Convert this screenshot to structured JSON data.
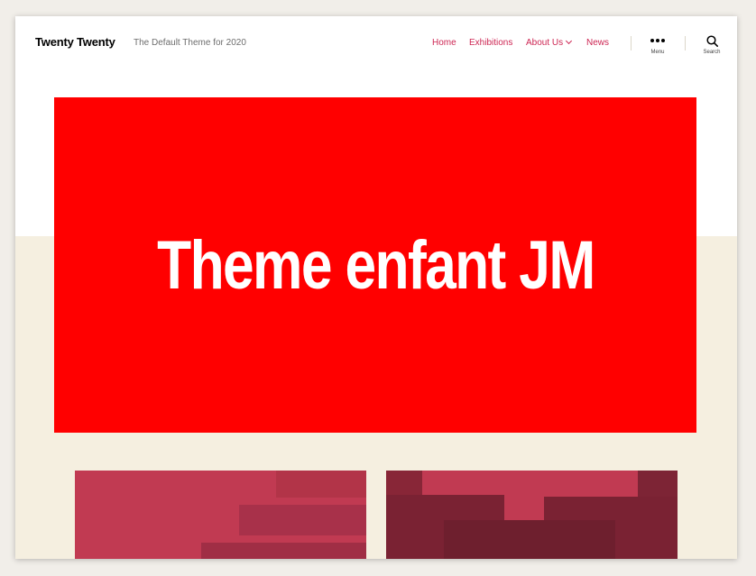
{
  "header": {
    "site_title": "Twenty Twenty",
    "site_description": "The Default Theme for 2020"
  },
  "nav": {
    "items": [
      {
        "label": "Home"
      },
      {
        "label": "Exhibitions"
      },
      {
        "label": "About Us",
        "has_submenu": true
      },
      {
        "label": "News"
      }
    ]
  },
  "toggles": {
    "menu_label": "Menu",
    "search_label": "Search"
  },
  "hero": {
    "title": "Theme enfant JM",
    "background": "#ff0000"
  },
  "colors": {
    "accent": "#cd2653",
    "beige": "#f5efe0",
    "card_primary": "#c13a52",
    "card_dark": "#6e1f2e"
  }
}
